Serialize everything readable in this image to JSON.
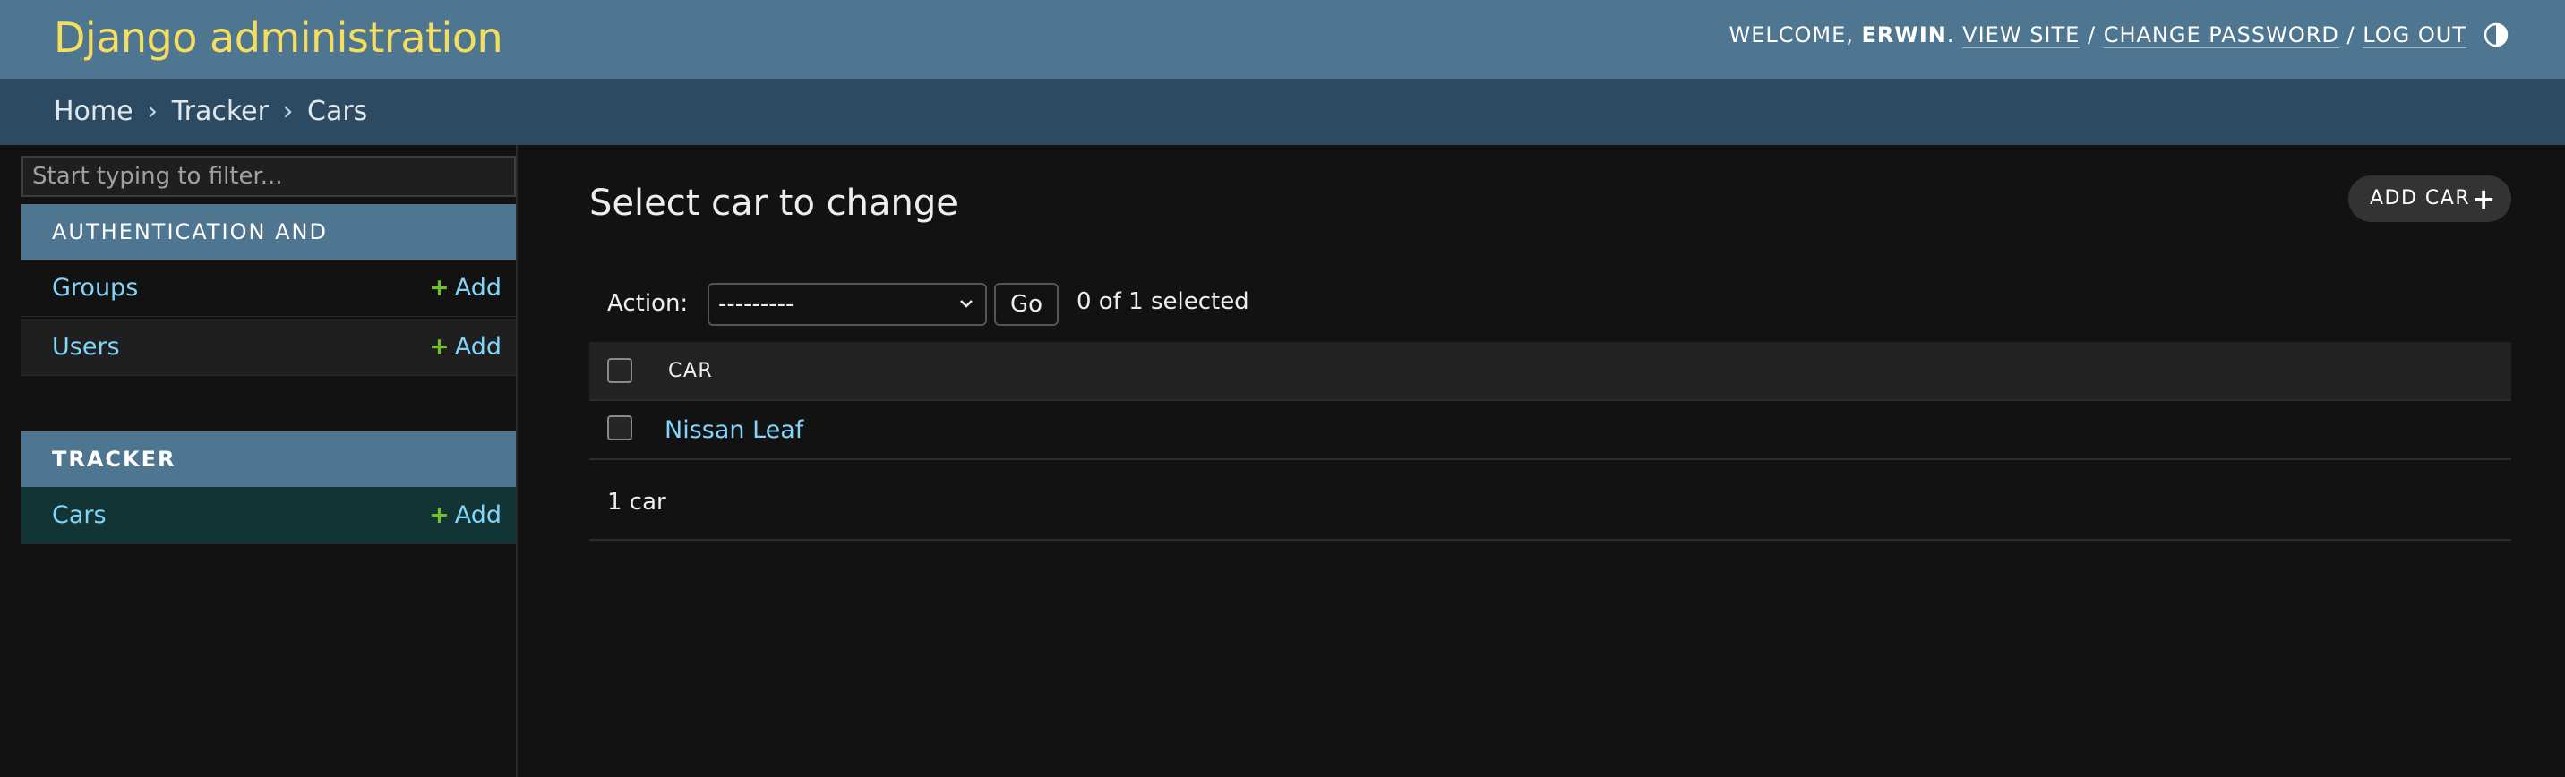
{
  "header": {
    "site_name": "Django administration",
    "welcome": "Welcome,",
    "username": "Erwin",
    "view_site": "View site",
    "change_password": "Change password",
    "log_out": "Log out",
    "separator": "/"
  },
  "breadcrumbs": {
    "home": "Home",
    "app": "Tracker",
    "current": "Cars",
    "separator": "›"
  },
  "sidebar": {
    "filter_placeholder": "Start typing to filter...",
    "modules": [
      {
        "caption": "Authentication and Authorization",
        "models": [
          {
            "name": "Groups",
            "add_label": "Add"
          },
          {
            "name": "Users",
            "add_label": "Add"
          }
        ]
      },
      {
        "caption": "Tracker",
        "models": [
          {
            "name": "Cars",
            "add_label": "Add"
          }
        ]
      }
    ]
  },
  "content": {
    "title": "Select car to change",
    "add_button": "Add car",
    "action_label": "Action:",
    "action_selected": "---------",
    "go_button": "Go",
    "selection_count": "0 of 1 selected",
    "table": {
      "column_header": "Car",
      "rows": [
        "Nissan Leaf"
      ]
    },
    "paginator": "1 car"
  },
  "colors": {
    "header_bg": "#4f7691",
    "site_name": "#f5dd5d",
    "breadcrumbs_bg": "#2c4b62",
    "link": "#81d4fa",
    "add_icon": "#70bf2b",
    "selected_row_bg": "#133434"
  }
}
